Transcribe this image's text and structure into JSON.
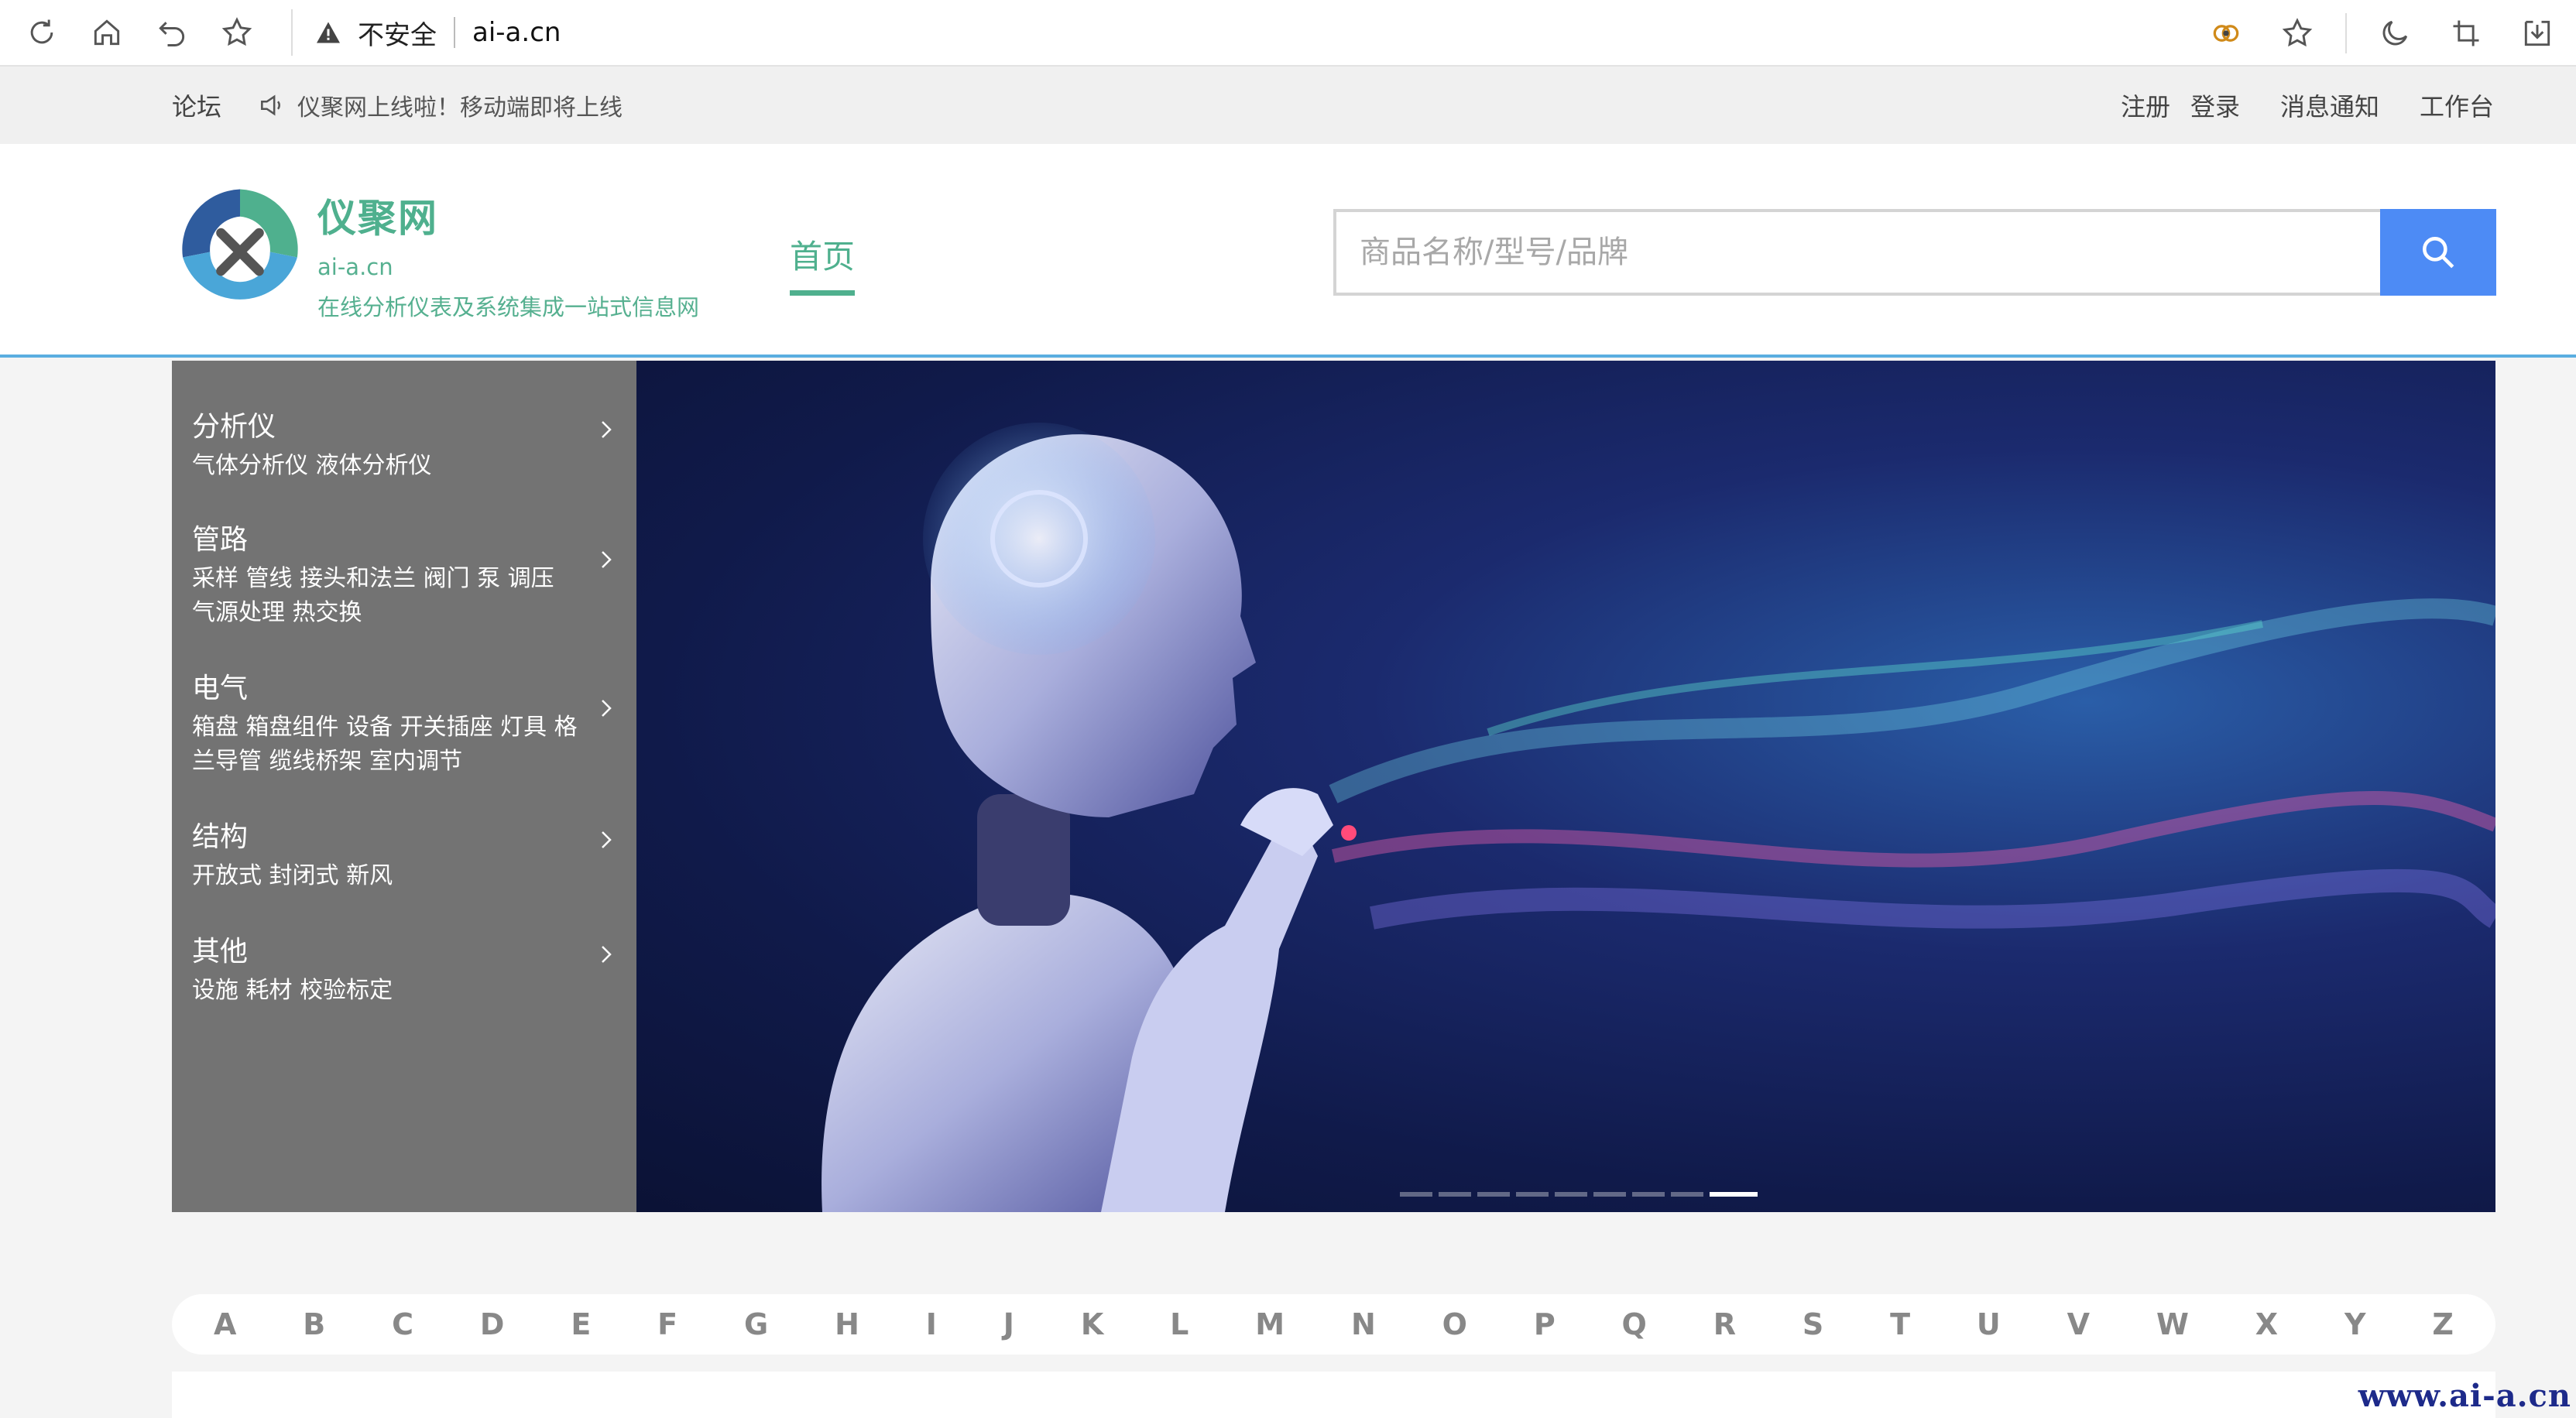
{
  "browser": {
    "insecure_label": "不安全",
    "url": "ai-a.cn",
    "icons": [
      "refresh-icon",
      "home-icon",
      "undo-icon",
      "star-icon",
      "warning-icon",
      "extension-icon",
      "star-icon",
      "moon-icon",
      "crop-icon",
      "download-icon"
    ]
  },
  "topbar": {
    "forum": "论坛",
    "notice": "仪聚网上线啦！移动端即将上线",
    "register": "注册",
    "login": "登录",
    "messages": "消息通知",
    "workbench": "工作台"
  },
  "header": {
    "brand_name": "仪聚网",
    "brand_domain": "ai-a.cn",
    "slogan": "在线分析仪表及系统集成一站式信息网",
    "nav_home": "首页",
    "search_placeholder": "商品名称/型号/品牌"
  },
  "colors": {
    "brand_green": "#4fb08e",
    "search_blue": "#4d8bf5",
    "menu_gray": "#737373",
    "header_line": "#5aaee0"
  },
  "categories": [
    {
      "title": "分析仪",
      "sub": "气体分析仪 液体分析仪"
    },
    {
      "title": "管路",
      "sub": "采样 管线 接头和法兰 阀门 泵 调压 气源处理 热交换"
    },
    {
      "title": "电气",
      "sub": "箱盘 箱盘组件 设备 开关插座 灯具 格兰导管 缆线桥架 室内调节"
    },
    {
      "title": "结构",
      "sub": "开放式 封闭式 新风"
    },
    {
      "title": "其他",
      "sub": "设施 耗材 校验标定"
    }
  ],
  "carousel": {
    "slide_count": 9,
    "active_index": 8
  },
  "alphabet": [
    "A",
    "B",
    "C",
    "D",
    "E",
    "F",
    "G",
    "H",
    "I",
    "J",
    "K",
    "L",
    "M",
    "N",
    "O",
    "P",
    "Q",
    "R",
    "S",
    "T",
    "U",
    "V",
    "W",
    "X",
    "Y",
    "Z"
  ],
  "watermark": "www.ai-a.cn"
}
